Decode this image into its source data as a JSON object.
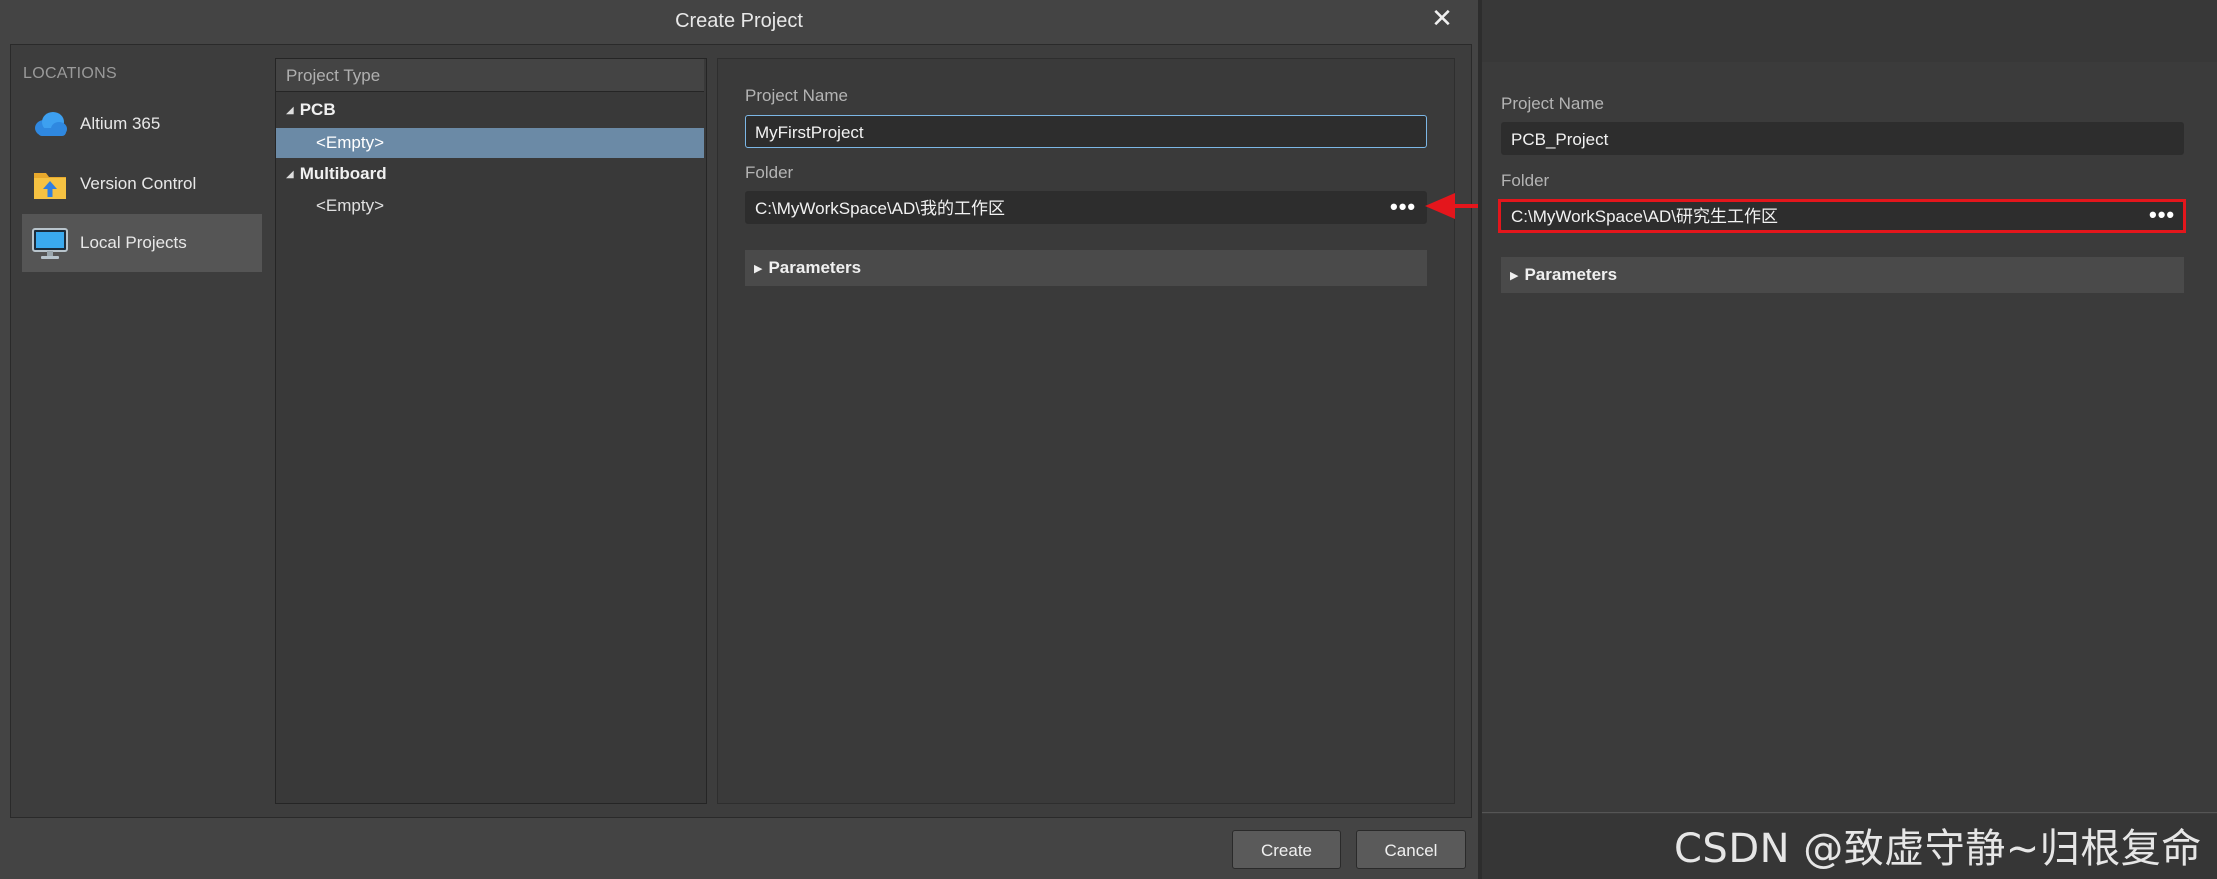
{
  "dialog": {
    "title": "Create Project",
    "close_icon": "close-icon"
  },
  "locations": {
    "header": "LOCATIONS",
    "items": [
      {
        "label": "Altium 365",
        "icon": "cloud-icon"
      },
      {
        "label": "Version Control",
        "icon": "folder-upload-icon"
      },
      {
        "label": "Local Projects",
        "icon": "monitor-icon",
        "selected": true
      }
    ]
  },
  "project_type": {
    "header": "Project Type",
    "groups": [
      {
        "label": "PCB",
        "items": [
          {
            "label": "<Empty>",
            "selected": true
          }
        ]
      },
      {
        "label": "Multiboard",
        "items": [
          {
            "label": "<Empty>",
            "selected": false
          }
        ]
      }
    ]
  },
  "settings": {
    "project_name_label": "Project Name",
    "project_name_value": "MyFirstProject",
    "folder_label": "Folder",
    "folder_value": "C:\\MyWorkSpace\\AD\\我的工作区",
    "browse_label": "•••",
    "parameters_label": "Parameters"
  },
  "buttons": {
    "create": "Create",
    "cancel": "Cancel"
  },
  "right_panel": {
    "project_name_label": "Project Name",
    "project_name_value": "PCB_Project",
    "folder_label": "Folder",
    "folder_value": "C:\\MyWorkSpace\\AD\\研究生工作区",
    "browse_label": "•••",
    "parameters_label": "Parameters"
  },
  "watermark": "CSDN @致虚守静~归根复命",
  "colors": {
    "selection": "#6b8aa6",
    "highlight": "#e4161c",
    "focus_border": "#7cb7e6"
  }
}
